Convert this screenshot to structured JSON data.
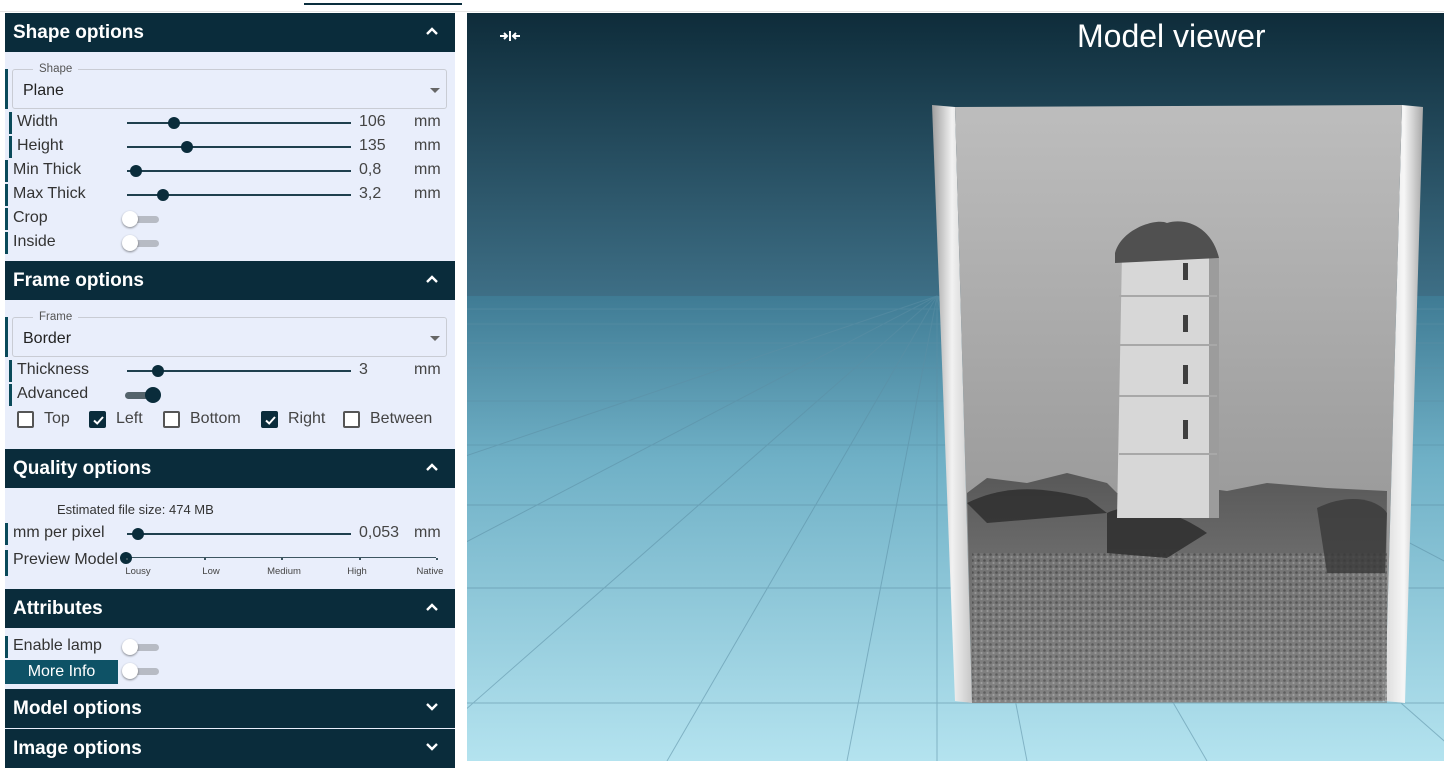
{
  "shape_section": {
    "title": "Shape options",
    "shape_select": {
      "legend": "Shape",
      "value": "Plane"
    },
    "sliders": [
      {
        "label": "Width",
        "value": "106",
        "unit": "mm",
        "fraction": 0.21
      },
      {
        "label": "Height",
        "value": "135",
        "unit": "mm",
        "fraction": 0.27
      },
      {
        "label": "Min Thick",
        "value": "0,8",
        "unit": "mm",
        "fraction": 0.04
      },
      {
        "label": "Max Thick",
        "value": "3,2",
        "unit": "mm",
        "fraction": 0.16
      }
    ],
    "toggles": [
      {
        "label": "Crop",
        "on": false
      },
      {
        "label": "Inside",
        "on": false
      }
    ]
  },
  "frame_section": {
    "title": "Frame options",
    "frame_select": {
      "legend": "Frame",
      "value": "Border"
    },
    "thickness": {
      "label": "Thickness",
      "value": "3",
      "unit": "mm",
      "fraction": 0.14
    },
    "advanced": {
      "label": "Advanced",
      "on": true
    },
    "checkboxes": [
      {
        "label": "Top",
        "checked": false
      },
      {
        "label": "Left",
        "checked": true
      },
      {
        "label": "Bottom",
        "checked": false
      },
      {
        "label": "Right",
        "checked": true
      },
      {
        "label": "Between",
        "checked": false
      }
    ]
  },
  "quality_section": {
    "title": "Quality options",
    "estimated_size": "Estimated file size: 474 MB",
    "mm_per_pixel": {
      "label": "mm per pixel",
      "value": "0,053",
      "unit": "mm",
      "fraction": 0.05
    },
    "preview_model": {
      "label": "Preview Model",
      "levels": [
        "Lousy",
        "Low",
        "Medium",
        "High",
        "Native"
      ],
      "selected": "Lousy"
    }
  },
  "attributes_section": {
    "title": "Attributes",
    "enable_lamp": {
      "label": "Enable lamp",
      "on": false
    },
    "more_info": {
      "label": "More Info",
      "on": false
    }
  },
  "model_section": {
    "title": "Model options"
  },
  "image_section": {
    "title": "Image options"
  },
  "viewer": {
    "title": "Model viewer"
  },
  "icons": {
    "section_expanded": "chevron-up-icon",
    "section_collapsed": "chevron-down-icon",
    "viewer_collapse": "collapse-arrows-icon"
  },
  "colors": {
    "header_bg": "#0a2c3b",
    "panel_bg": "#e9eefb",
    "accent": "#0a4a5a",
    "more_info_bg": "#0e5266"
  }
}
